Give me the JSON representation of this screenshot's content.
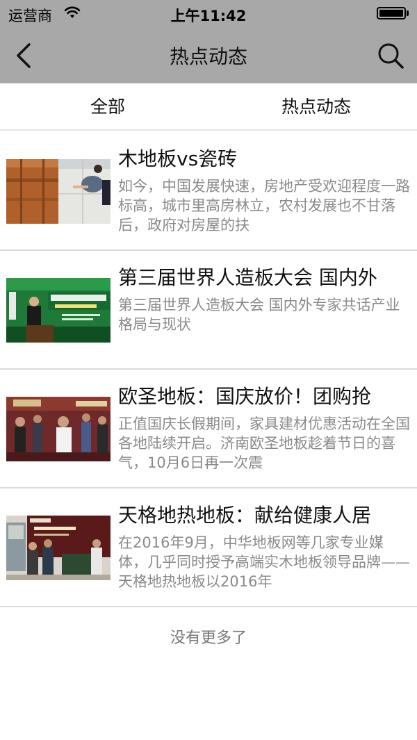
{
  "status_bar": {
    "carrier": "运营商",
    "time": "上午11:42"
  },
  "nav": {
    "title": "热点动态",
    "back_icon": "chevron-left-icon",
    "search_icon": "search-icon"
  },
  "tabs": [
    {
      "label": "全部"
    },
    {
      "label": "热点动态"
    }
  ],
  "articles": [
    {
      "title": "木地板vs瓷砖",
      "summary": "如今，中国发展快速，房地产受欢迎程度一路标高，城市里高房林立，农村发展也不甘落后，政府对房屋的扶"
    },
    {
      "title": "第三届世界人造板大会 国内外",
      "summary": "第三届世界人造板大会 国内外专家共话产业格局与现状"
    },
    {
      "title": "欧圣地板：国庆放价！团购抢",
      "summary": "正值国庆长假期间，家具建材优惠活动在全国各地陆续开启。济南欧圣地板趁着节日的喜气，10月6日再一次震"
    },
    {
      "title": "天格地热地板：献给健康人居",
      "summary": "在2016年9月，中华地板网等几家专业媒体，几乎同时授予高端实木地板领导品牌——天格地热地板以2016年"
    }
  ],
  "footer": {
    "no_more_text": "没有更多了"
  },
  "colors": {
    "nav_background": "#a8a8a8",
    "summary_text": "#8a8a8a",
    "divider": "#dcdcdc"
  }
}
